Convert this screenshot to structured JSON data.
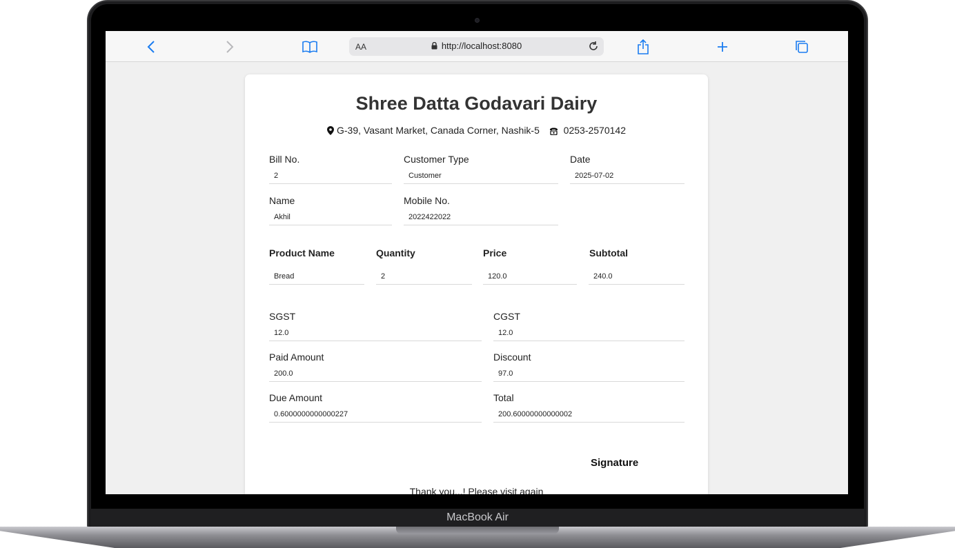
{
  "browser": {
    "reader_label": "AA",
    "url": "http://localhost:8080"
  },
  "laptop": {
    "model_label": "MacBook Air"
  },
  "bill": {
    "shop_name": "Shree Datta Godavari Dairy",
    "address": "G-39, Vasant Market, Canada Corner, Nashik-5",
    "phone": "0253-2570142",
    "fields": {
      "bill_no": {
        "label": "Bill No.",
        "value": "2"
      },
      "customer_type": {
        "label": "Customer Type",
        "value": "Customer"
      },
      "date": {
        "label": "Date",
        "value": "2025-07-02"
      },
      "name": {
        "label": "Name",
        "value": "Akhil"
      },
      "mobile": {
        "label": "Mobile No.",
        "value": "2022422022"
      }
    },
    "products": {
      "headers": [
        "Product Name",
        "Quantity",
        "Price",
        "Subtotal"
      ],
      "rows": [
        {
          "product": "Bread",
          "quantity": "2",
          "price": "120.0",
          "subtotal": "240.0"
        }
      ]
    },
    "summary": {
      "sgst": {
        "label": "SGST",
        "value": "12.0"
      },
      "cgst": {
        "label": "CGST",
        "value": "12.0"
      },
      "paid": {
        "label": "Paid Amount",
        "value": "200.0"
      },
      "discount": {
        "label": "Discount",
        "value": "97.0"
      },
      "due": {
        "label": "Due Amount",
        "value": "0.6000000000000227"
      },
      "total": {
        "label": "Total",
        "value": "200.60000000000002"
      }
    },
    "signature_label": "Signature",
    "thanks": "Thank you...! Please visit again"
  },
  "colors": {
    "accent": "#1a7cf0",
    "page_bg": "#f0f0f0",
    "card_bg": "#ffffff"
  },
  "icons": [
    "back-icon",
    "forward-icon",
    "bookmarks-icon",
    "lock-icon",
    "reload-icon",
    "share-icon",
    "plus-icon",
    "tabs-icon",
    "location-pin-icon",
    "phone-icon"
  ]
}
